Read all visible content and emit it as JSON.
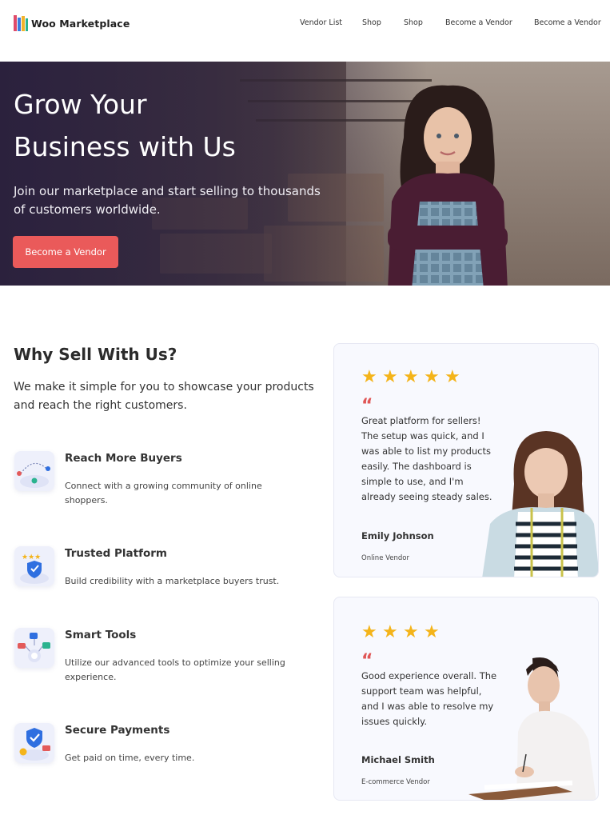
{
  "brand": {
    "name": "Woo Marketplace"
  },
  "nav": {
    "items": [
      "Vendor List",
      "Shop",
      "Shop",
      "Become a Vendor",
      "Become a Vendor"
    ]
  },
  "hero": {
    "title_line1": "Grow Your",
    "title_line2": "Business with Us",
    "subtitle": "Join our marketplace and start selling to thousands of customers worldwide.",
    "cta": "Become a Vendor"
  },
  "why": {
    "title": "Why Sell With Us?",
    "subtitle": "We make it simple for you to showcase your products and reach the right customers.",
    "features": [
      {
        "title": "Reach More Buyers",
        "desc": "Connect with a growing community of online shoppers.",
        "icon": "map-pins-icon"
      },
      {
        "title": "Trusted Platform",
        "desc": "Build credibility with a marketplace buyers trust.",
        "icon": "shield-stars-icon"
      },
      {
        "title": "Smart Tools",
        "desc": "Utilize our advanced tools to optimize your selling experience.",
        "icon": "tools-network-icon"
      },
      {
        "title": "Secure Payments",
        "desc": "Get paid on time, every time.",
        "icon": "secure-payment-icon"
      }
    ]
  },
  "testimonials": [
    {
      "stars": 5,
      "quote_mark": "“",
      "text": "Great platform for sellers! The setup was quick, and I was able to list my products easily. The dashboard is simple to use, and I'm already seeing steady sales.",
      "name": "Emily Johnson",
      "role": "Online Vendor"
    },
    {
      "stars": 4,
      "quote_mark": "“",
      "text": "Good experience overall. The support team was helpful, and I was able to resolve my issues quickly.",
      "name": "Michael Smith",
      "role": "E-commerce Vendor"
    }
  ],
  "colors": {
    "accent": "#ea5a5a",
    "star": "#f4b41a",
    "shield": "#2f6fe0",
    "card_bg": "#f8f9fe"
  }
}
